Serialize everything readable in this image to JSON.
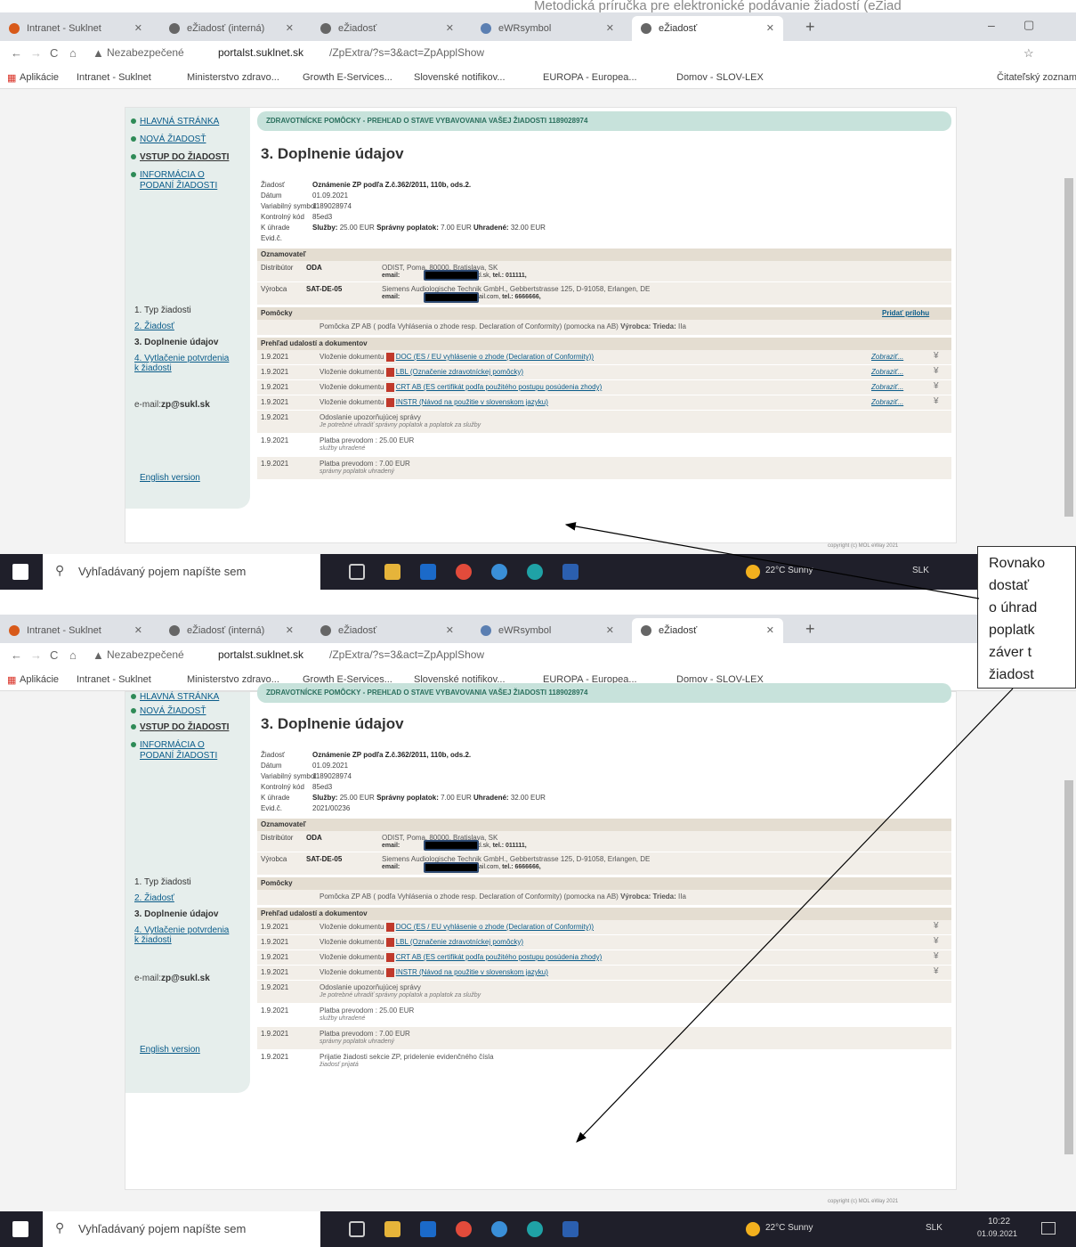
{
  "doc_header": "Metodická príručka pre elektronické podávanie žiadostí (eŽiad",
  "browser": {
    "tabs": [
      "Intranet - Suklnet",
      "eŽiadosť (interná)",
      "eŽiadosť",
      "eWRsymbol",
      "eŽiadosť"
    ],
    "url_prefix": "Nezabezpečené",
    "url_host": "portalst.suklnet.sk",
    "url_path": "/ZpExtra/?s=3&act=ZpApplShow",
    "bookmarks": [
      "Aplikácie",
      "Intranet - Suklnet",
      "Ministerstvo zdravo...",
      "Growth E-Services...",
      "Slovenské notifikov...",
      "EUROPA - Europea...",
      "Domov - SLOV-LEX",
      "Čitateľský zoznam"
    ]
  },
  "sidebar": {
    "nav": [
      "HLAVNÁ STRÁNKA",
      "NOVÁ ŽIADOSŤ",
      "VSTUP DO ŽIADOSTI",
      "INFORMÁCIA O",
      "PODANÍ ŽIADOSTI"
    ],
    "steps": [
      "1. Typ žiadosti",
      "2. Žiadosť",
      "3. Doplnenie údajov",
      "4. Vytlačenie potvrdenia",
      "k žiadosti"
    ],
    "email_label": "e-mail:",
    "email": "zp@sukl.sk",
    "english": "English version"
  },
  "page": {
    "banner": "ZDRAVOTNÍCKE POMÔCKY - PREHĽAD O STAVE VYBAVOVANIA VAŠEJ ŽIADOSTI 1189028974",
    "title": "3. Doplnenie údajov",
    "labels": [
      "Žiadosť",
      "Dátum",
      "Variabilný symbol",
      "Kontrolný kód",
      "K úhrade",
      "Evid.č."
    ],
    "values": {
      "ziadost": "Oznámenie ZP podľa Z.č.362/2011, 110b, ods.2.",
      "datum": "01.09.2021",
      "vs": "1189028974",
      "kod": "85ed3",
      "sluzby_label": "Služby:",
      "sluzby": "25.00 EUR",
      "poplatok_label": "Správny poplatok:",
      "poplatok": "7.00 EUR",
      "uhradene_label": "Uhradené:",
      "uhradene": "32.00 EUR",
      "evid": "2021/00236"
    },
    "oznamovatel": "Oznamovateľ",
    "distributor_label": "Distribútor",
    "distributor_code": "ODA",
    "distributor_addr": "ODIST, Poma, 80000, Bratislava, SK",
    "distributor_email": "email:",
    "distributor_email_tail": "@sukl.sk,",
    "distributor_tel": "tel.: 011111,",
    "vyrobca_label": "Výrobca",
    "vyrobca_code": "SAT-DE-05",
    "vyrobca_addr": "Siemens Audiologische Technik GmbH., Gebbertstrasse 125, D-91058, Erlangen, DE",
    "vyrobca_email": "email:",
    "vyrobca_email_tail": "@gmail.com,",
    "vyrobca_tel": "tel.: 6666666,",
    "pomocky": "Pomôcky",
    "pridat": "Pridať prílohu",
    "pomocka_text": "Pomôcka ZP AB ( podľa Vyhlásenia o zhode resp. Declaration of Conformity) (pomocka na AB)",
    "vyrobca_lbl": "Výrobca:",
    "trieda_lbl": "Trieda:",
    "trieda": "IIa",
    "prehlad": "Prehľad udalostí a dokumentov",
    "zobrazit": "Zobraziť...",
    "events": [
      {
        "date": "1.9.2021",
        "text": "Vloženie dokumentu",
        "link": "DOC (ES / EU vyhlásenie o zhode (Declaration of Conformity))"
      },
      {
        "date": "1.9.2021",
        "text": "Vloženie dokumentu",
        "link": "LBL (Označenie zdravotníckej pomôcky)"
      },
      {
        "date": "1.9.2021",
        "text": "Vloženie dokumentu",
        "link": "CRT AB (ES certifikát podľa použitého postupu posúdenia zhody)"
      },
      {
        "date": "1.9.2021",
        "text": "Vloženie dokumentu",
        "link": "INSTR (Návod na použitie v slovenskom jazyku)"
      },
      {
        "date": "1.9.2021",
        "text": "Odoslanie upozorňujúcej správy",
        "sub": "Je potrebné uhradiť správny poplatok a poplatok za služby"
      },
      {
        "date": "1.9.2021",
        "text": "Platba prevodom : 25.00 EUR",
        "sub": "služby uhradené"
      },
      {
        "date": "1.9.2021",
        "text": "Platba prevodom : 7.00 EUR",
        "sub": "správny poplatok uhradený"
      },
      {
        "date": "1.9.2021",
        "text": "Prijatie žiadosti sekcie ZP, pridelenie evidenčného čísla",
        "sub": "žiadosť prijatá"
      }
    ],
    "footer": "copyright (c) MOL eWay 2021"
  },
  "taskbar": {
    "search": "Vyhľadávaný pojem napíšte sem",
    "weather": "22°C Sunny",
    "lang": "SLK",
    "time": "10:22",
    "date": "01.09.2021"
  },
  "callout": {
    "lines": [
      "Rovnako",
      "dostať",
      "o úhrad",
      "poplatk",
      "záver t",
      "žiadost"
    ]
  }
}
